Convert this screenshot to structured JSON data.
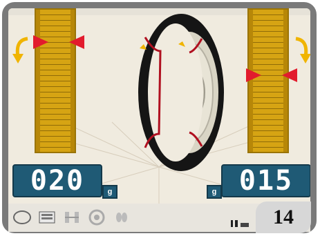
{
  "left_readout": {
    "value": "020",
    "unit": "g"
  },
  "right_readout": {
    "value": "015",
    "unit": "g"
  },
  "page_number": "14",
  "toolbar": {
    "icons": [
      "tire-outline-icon",
      "monitor-settings-icon",
      "balance-weights-icon",
      "wheel-clamp-icon",
      "footprints-icon"
    ]
  },
  "colors": {
    "gauge_fill": "#d6a413",
    "readout_bg": "#1f5a75",
    "marker_red": "#e21b2d",
    "arrow_yellow": "#f0b400"
  }
}
